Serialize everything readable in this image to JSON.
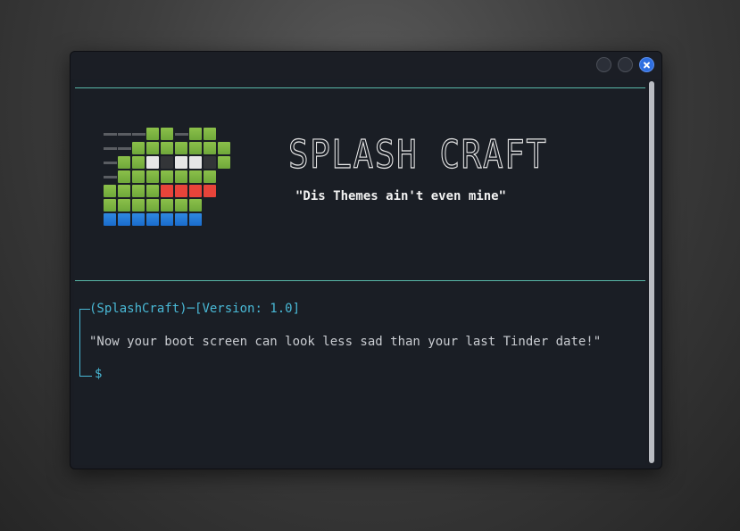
{
  "window": {
    "controls": [
      {
        "name": "minimize-button",
        "icon": "minimize-icon"
      },
      {
        "name": "maximize-button",
        "icon": "maximize-icon"
      },
      {
        "name": "close-button",
        "icon": "close-icon"
      }
    ],
    "accent": "#2f6fe0"
  },
  "splash": {
    "title": "SPLASH CRAFT",
    "tagline": "\"Dis Themes ain't even mine\"",
    "logo_icon": "creeper-pixel-logo",
    "colors": {
      "green": "#7ab342",
      "red": "#e8443a",
      "blue": "#1f75d6",
      "white": "#e6e6e6",
      "dark": "#333538",
      "rule": "#58b8a8",
      "prompt": "#49b9d6"
    }
  },
  "prompt": {
    "app": "(SplashCraft)",
    "connector": "─",
    "version": "[Version: 1.0]",
    "quote": "\"Now your boot screen can look less sad than your last Tinder date!\"",
    "symbol": "$"
  }
}
